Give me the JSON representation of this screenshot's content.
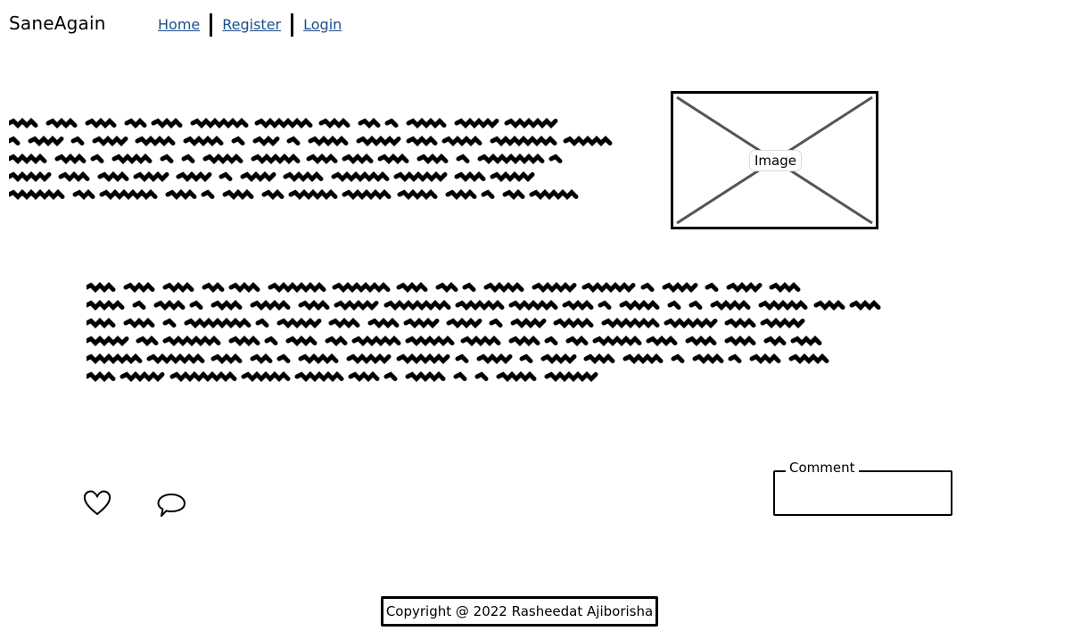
{
  "header": {
    "brand": "SaneAgain",
    "nav": [
      {
        "label": "Home"
      },
      {
        "label": "Register"
      },
      {
        "label": "Login"
      }
    ]
  },
  "main": {
    "image_label": "Image",
    "comment_legend": "Comment"
  },
  "icons": {
    "like": "heart-icon",
    "comment": "speech-bubble-icon"
  },
  "footer": {
    "copyright": "Copyright @ 2022 Rasheedat Ajiborisha"
  }
}
